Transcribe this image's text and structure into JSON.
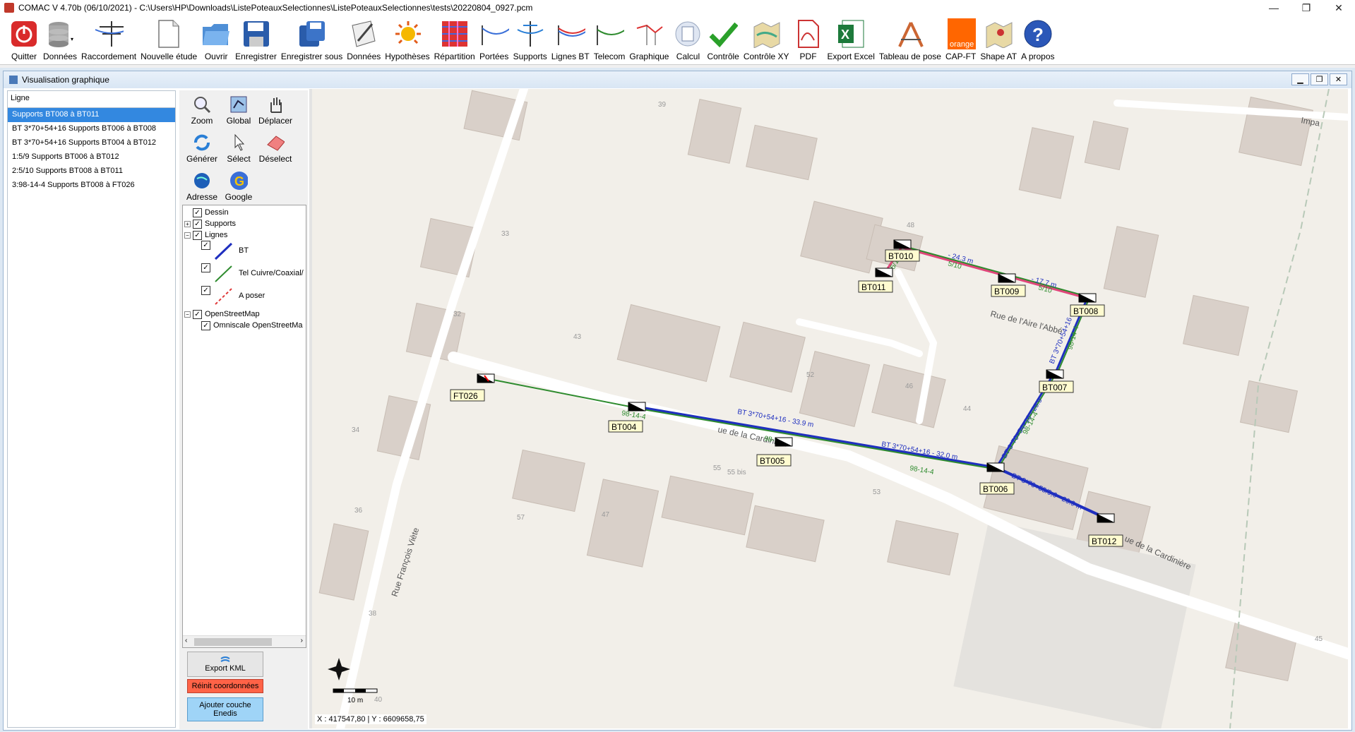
{
  "window": {
    "title": "COMAC V 4.70b (06/10/2021) - C:\\Users\\HP\\Downloads\\ListePoteauxSelectionnes\\ListePoteauxSelectionnes\\tests\\20220804_0927.pcm",
    "minimize": "—",
    "maximize": "❐",
    "close": "✕"
  },
  "toolbar": {
    "items": [
      {
        "label": "Quitter",
        "icon": "power-icon"
      },
      {
        "label": "Données",
        "icon": "database-icon"
      },
      {
        "label": "Raccordement",
        "icon": "pylon-icon"
      },
      {
        "label": "Nouvelle étude",
        "icon": "new-document-icon"
      },
      {
        "label": "Ouvrir",
        "icon": "folder-icon"
      },
      {
        "label": "Enregistrer",
        "icon": "save-icon"
      },
      {
        "label": "Enregistrer sous",
        "icon": "save-as-icon"
      },
      {
        "label": "Données",
        "icon": "edit-data-icon"
      },
      {
        "label": "Hypothèses",
        "icon": "sun-icon"
      },
      {
        "label": "Répartition",
        "icon": "grid-icon"
      },
      {
        "label": "Portées",
        "icon": "span-icon"
      },
      {
        "label": "Supports",
        "icon": "pole-icon"
      },
      {
        "label": "Lignes BT",
        "icon": "lines-bt-icon"
      },
      {
        "label": "Telecom",
        "icon": "telecom-icon"
      },
      {
        "label": "Graphique",
        "icon": "graph-icon"
      },
      {
        "label": "Calcul",
        "icon": "calculator-icon"
      },
      {
        "label": "Contrôle",
        "icon": "checkmark-icon"
      },
      {
        "label": "Contrôle XY",
        "icon": "map-check-icon"
      },
      {
        "label": "PDF",
        "icon": "pdf-icon"
      },
      {
        "label": "Export Excel",
        "icon": "excel-icon"
      },
      {
        "label": "Tableau de pose",
        "icon": "ruler-icon"
      },
      {
        "label": "CAP-FT",
        "icon": "orange-icon",
        "badge": "orange"
      },
      {
        "label": "Shape AT",
        "icon": "map-shape-icon"
      },
      {
        "label": "A propos",
        "icon": "help-icon"
      }
    ]
  },
  "panel": {
    "title": "Visualisation graphique",
    "list_header": "Ligne",
    "lines": [
      "Supports BT008 à BT011",
      "BT  3*70+54+16 Supports BT006 à BT008",
      "BT  3*70+54+16 Supports BT004 à BT012",
      "1:5/9 Supports BT006 à BT012",
      "2:5/10 Supports BT008 à BT011",
      "3:98-14-4 Supports BT008 à FT026"
    ]
  },
  "tools": {
    "zoom": "Zoom",
    "global": "Global",
    "pan": "Déplacer",
    "generate": "Générer",
    "select": "Sélect",
    "deselect": "Déselect",
    "address": "Adresse",
    "google": "Google"
  },
  "layers": {
    "dessin": "Dessin",
    "supports": "Supports",
    "lignes": "Lignes",
    "bt": "BT",
    "tel": "Tel Cuivre/Coaxial/",
    "a_poser": "A poser",
    "osm": "OpenStreetMap",
    "omniscale": "Omniscale OpenStreetMa"
  },
  "buttons": {
    "export_kml": "Export KML",
    "reset_coords": "Réinit coordonnées",
    "add_layer": "Ajouter couche Enedis"
  },
  "map": {
    "coords": "X : 417547,80 | Y : 6609658,75",
    "scale": "10 m",
    "streets": [
      "Rue de l'Aire l'Abbé",
      "ue de la Cardinière",
      "ue de la Cardinière",
      "Rue François Viète",
      "Impa"
    ],
    "house_numbers": [
      "39",
      "33",
      "32",
      "43",
      "34",
      "36",
      "38",
      "40",
      "47",
      "57",
      "55",
      "55 bis",
      "53",
      "52",
      "46",
      "44",
      "45",
      "48"
    ],
    "supports": [
      "FT026",
      "BT004",
      "BT005",
      "BT006",
      "BT007",
      "BT008",
      "BT009",
      "BT010",
      "BT011",
      "BT012"
    ],
    "span_labels": [
      "BT 3*70+54+16 - 33.9 m",
      "BT 3*70+54+16 - 32.0 m",
      "BT 3*70+54+16 - 26.9",
      "BT 3*70+55/9,6 - 26.9 m",
      "BT 3*70+54+16 -",
      "98-14-4",
      "98-14-4",
      "98-14-4",
      "98-14-4",
      "98-14-4",
      "- 24.3 m",
      "5/10",
      "- 17.7 m",
      "5/10",
      "5/10"
    ]
  },
  "colors": {
    "bt_line": "#1f2fbf",
    "tel_line": "#2e8b2e",
    "pose_line": "#e03a3a",
    "selected": "#3388e0",
    "reset_btn": "#ff6347",
    "add_btn": "#9fd4f7"
  }
}
